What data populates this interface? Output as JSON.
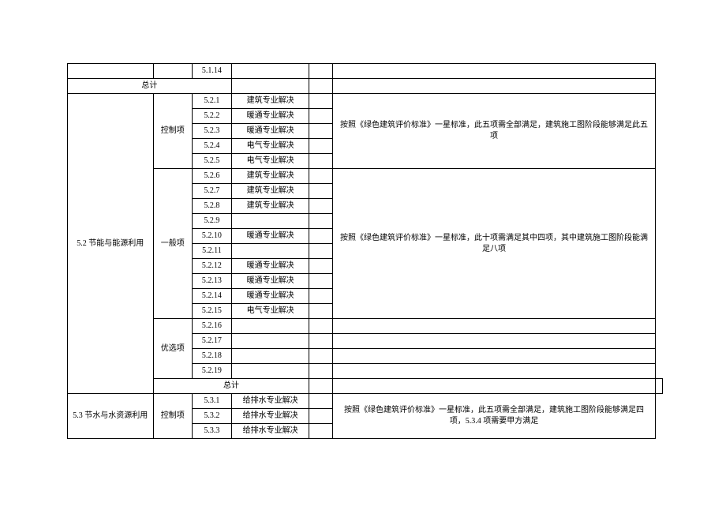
{
  "rows": {
    "r1_code": "5.1.14",
    "total_label": "总计",
    "section52": {
      "title": "5.2 节能与能源利用",
      "control_label": "控制项",
      "general_label": "一般项",
      "preferred_label": "优选项",
      "control": [
        {
          "code": "5.2.1",
          "resolve": "建筑专业解决"
        },
        {
          "code": "5.2.2",
          "resolve": "暖通专业解决"
        },
        {
          "code": "5.2.3",
          "resolve": "暖通专业解决"
        },
        {
          "code": "5.2.4",
          "resolve": "电气专业解决"
        },
        {
          "code": "5.2.5",
          "resolve": "电气专业解决"
        }
      ],
      "control_note": "按照《绿色建筑评价标准》一星标准，此五项需全部满足，建筑施工图阶段能够满足此五项",
      "general": [
        {
          "code": "5.2.6",
          "resolve": "建筑专业解决"
        },
        {
          "code": "5.2.7",
          "resolve": "建筑专业解决"
        },
        {
          "code": "5.2.8",
          "resolve": "建筑专业解决"
        },
        {
          "code": "5.2.9",
          "resolve": ""
        },
        {
          "code": "5.2.10",
          "resolve": "暖通专业解决"
        },
        {
          "code": "5.2.11",
          "resolve": ""
        },
        {
          "code": "5.2.12",
          "resolve": "暖通专业解决"
        },
        {
          "code": "5.2.13",
          "resolve": "暖通专业解决"
        },
        {
          "code": "5.2.14",
          "resolve": "暖通专业解决"
        },
        {
          "code": "5.2.15",
          "resolve": "电气专业解决"
        }
      ],
      "general_note": "按照《绿色建筑评价标准》一星标准，此十项需满足其中四项，其中建筑施工图阶段能满足八项",
      "preferred": [
        {
          "code": "5.2.16",
          "resolve": ""
        },
        {
          "code": "5.2.17",
          "resolve": ""
        },
        {
          "code": "5.2.18",
          "resolve": ""
        },
        {
          "code": "5.2.19",
          "resolve": ""
        }
      ]
    },
    "section53": {
      "title": "5.3 节水与水资源利用",
      "control_label": "控制项",
      "control": [
        {
          "code": "5.3.1",
          "resolve": "给排水专业解决"
        },
        {
          "code": "5.3.2",
          "resolve": "给排水专业解决"
        },
        {
          "code": "5.3.3",
          "resolve": "给排水专业解决"
        }
      ],
      "control_note": "按照《绿色建筑评价标准》一星标准，此五项需全部满足，建筑施工图阶段能够满足四项，5.3.4 项需要甲方满足"
    }
  }
}
